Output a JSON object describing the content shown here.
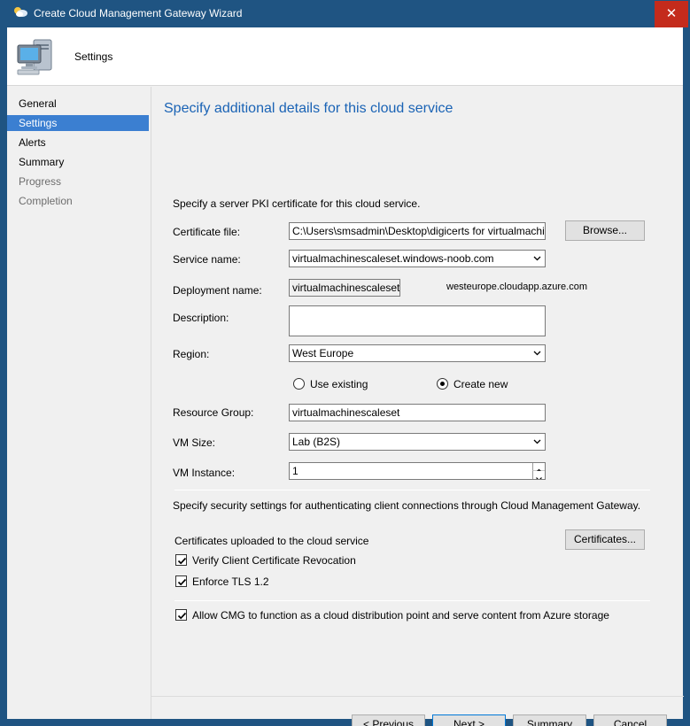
{
  "window": {
    "title": "Create Cloud Management Gateway Wizard",
    "close_glyph": "✕",
    "icon": "cloud-gateway-icon"
  },
  "header": {
    "page_title": "Settings",
    "icon": "computer-icon"
  },
  "nav": {
    "items": [
      {
        "label": "General",
        "state": "normal"
      },
      {
        "label": "Settings",
        "state": "active"
      },
      {
        "label": "Alerts",
        "state": "normal"
      },
      {
        "label": "Summary",
        "state": "normal"
      },
      {
        "label": "Progress",
        "state": "disabled"
      },
      {
        "label": "Completion",
        "state": "disabled"
      }
    ]
  },
  "content": {
    "heading": "Specify additional details for this cloud service",
    "pki_intro": "Specify a server PKI certificate for this cloud service.",
    "certificate_file": {
      "label": "Certificate file:",
      "value": "C:\\Users\\smsadmin\\Desktop\\digicerts for virtualmachinesca",
      "browse_label": "Browse..."
    },
    "service_name": {
      "label": "Service name:",
      "value": "virtualmachinescaleset.windows-noob.com"
    },
    "deployment_name": {
      "label": "Deployment name:",
      "value": "virtualmachinescaleset",
      "suffix": "westeurope.cloudapp.azure.com"
    },
    "description": {
      "label": "Description:",
      "value": ""
    },
    "region": {
      "label": "Region:",
      "value": "West Europe"
    },
    "resource_group_mode": {
      "use_existing_label": "Use existing",
      "create_new_label": "Create new",
      "selected": "create_new"
    },
    "resource_group": {
      "label": "Resource Group:",
      "value": "virtualmachinescaleset"
    },
    "vm_size": {
      "label": "VM Size:",
      "value": "Lab (B2S)"
    },
    "vm_instance": {
      "label": "VM Instance:",
      "value": "1"
    },
    "security_intro": "Specify security settings for authenticating client connections through Cloud Management Gateway.",
    "certificates_uploaded_label": "Certificates uploaded to the cloud service",
    "certificates_button_label": "Certificates...",
    "verify_revocation": {
      "label": "Verify Client Certificate Revocation",
      "checked": true
    },
    "enforce_tls": {
      "label": "Enforce TLS 1.2",
      "checked": true
    },
    "allow_cdp": {
      "label": "Allow CMG to function as a cloud distribution point and serve content from Azure storage",
      "checked": true
    }
  },
  "footer": {
    "previous_label": "< Previous",
    "next_label": "Next >",
    "summary_label": "Summary",
    "cancel_label": "Cancel"
  },
  "colors": {
    "titlebar": "#1f5482",
    "close_button": "#c42b1c",
    "heading": "#1a63b5",
    "nav_active": "#3b7fd1",
    "default_button_border": "#0078d7"
  }
}
